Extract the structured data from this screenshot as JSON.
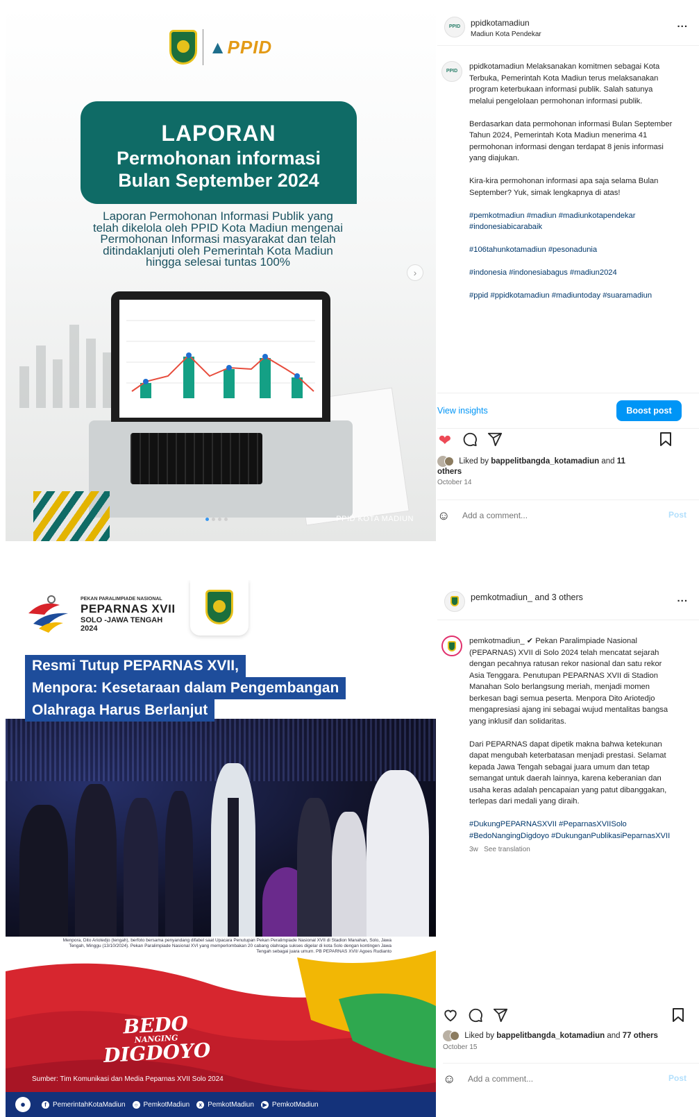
{
  "post1": {
    "media": {
      "ppid_logo": "PPID",
      "title_line1": "LAPORAN",
      "title_line2": "Permohonan informasi",
      "title_line3": "Bulan September 2024",
      "subtitle": "Laporan Permohonan Informasi Publik yang telah dikelola oleh PPID Kota Madiun mengenai Permohonan Informasi masyarakat dan telah ditindaklanjuti oleh Pemerintah Kota Madiun hingga selesai tuntas 100%",
      "footer": "PPID KOTA MADIUN",
      "next_icon": "chevron-right-icon"
    },
    "header": {
      "username": "ppidkotamadiun",
      "location": "Madiun Kota Pendekar",
      "avatar_text": "PPID",
      "more": "..."
    },
    "caption": {
      "p1": "ppidkotamadiun Melaksanakan komitmen sebagai Kota Terbuka, Pemerintah Kota Madiun terus melaksanakan program keterbukaan informasi publik. Salah satunya melalui pengelolaan permohonan informasi publik.",
      "p2": "Berdasarkan data permohonan informasi Bulan September Tahun 2024, Pemerintah Kota Madiun menerima 41 permohonan informasi dengan terdapat 8 jenis informasi yang diajukan.",
      "p3": "Kira-kira permohonan informasi apa saja selama Bulan September? Yuk, simak lengkapnya di atas!",
      "tags1": "#pemkotmadiun #madiun #madiunkotapendekar #indonesiabicarabaik",
      "tags2": "#106tahunkotamadiun #pesonadunia",
      "tags3": "#indonesia #indonesiabagus #madiun2024",
      "tags4": "#ppid #ppidkotamadiun #madiuntoday #suaramadiun"
    },
    "view_insights": "View insights",
    "boost_post": "Boost post",
    "liked_prefix": "Liked by",
    "liked_user": "bappelitbangda_kotamadiun",
    "liked_and": "and",
    "liked_others": "11 others",
    "date": "October 14",
    "comment_placeholder": "Add a comment...",
    "post_button": "Post",
    "liked": true
  },
  "post2": {
    "media": {
      "event_small": "PEKAN PARALIMPIADE NASIONAL",
      "event_big": "PEPARNAS XVII",
      "event_sub": "SOLO -JAWA TENGAH",
      "event_year": "2024",
      "headline1": "Resmi Tutup PEPARNAS XVII,",
      "headline2": "Menpora: Kesetaraan dalam Pengembangan",
      "headline3": "Olahraga Harus Berlanjut",
      "photo_caption": "Menpora, Dito Ariotedjo (tengah), berfoto bersama penyandang difabel saat Upacara Penutupan Pekan Peralimpiade Nasional XVII di Stadion Manahan, Solo, Jawa Tengah, Minggu (13/10/2024). Pekan Paralimpiade Nasional XVI yang memperlombakan 20 cabang olahraga sukses digelar di kota Solo dengan kontingen Jawa Tengah sebagai juara umum. PB PEPARNAS XVII/ Agoes Rudianto",
      "bedo1": "BEDO",
      "bedo2": "NANGING",
      "bedo3": "DIGDOYO",
      "source": "Sumber: Tim Komunikasi dan Media Peparnas XVII Solo 2024",
      "social": [
        "PemerintahKotaMadiun",
        "PemkotMadiun",
        "PemkotMadiun",
        "PemkotMadiun"
      ]
    },
    "header": {
      "username": "pemkotmadiun_ and 3 others",
      "more": "..."
    },
    "caption": {
      "p1": "pemkotmadiun_ ✔ Pekan Paralimpiade Nasional (PEPARNAS) XVII di Solo 2024 telah mencatat sejarah dengan pecahnya ratusan rekor nasional dan satu rekor Asia Tenggara. Penutupan PEPARNAS XVII di Stadion Manahan Solo berlangsung meriah, menjadi momen berkesan bagi semua peserta. Menpora Dito Ariotedjo mengapresiasi ajang ini sebagai wujud mentalitas bangsa yang inklusif dan solidaritas.",
      "p2": "Dari PEPARNAS dapat dipetik makna bahwa ketekunan dapat mengubah keterbatasan menjadi prestasi. Selamat kepada Jawa Tengah sebagai juara umum dan tetap semangat untuk daerah lainnya, karena keberanian dan usaha keras adalah pencapaian yang patut dibanggakan, terlepas dari medali yang diraih.",
      "tags": "#DukungPEPARNASXVII #PeparnasXVIISolo #BedoNangingDigdoyo #DukunganPublikasiPeparnasXVII",
      "age": "3w",
      "see_translation": "See translation"
    },
    "liked_prefix": "Liked by",
    "liked_user": "bappelitbangda_kotamadiun",
    "liked_and": "and",
    "liked_others": "77 others",
    "date": "October 15",
    "comment_placeholder": "Add a comment...",
    "post_button": "Post",
    "liked": false
  },
  "colors": {
    "teal": "#0f6b66",
    "ig_blue": "#0095f6",
    "heart_red": "#ed4956",
    "peparnas_blue": "#1e4d9b"
  },
  "icons": {
    "like": "heart-icon",
    "comment": "comment-icon",
    "share": "send-icon",
    "save": "bookmark-icon",
    "emoji": "emoji-icon"
  }
}
